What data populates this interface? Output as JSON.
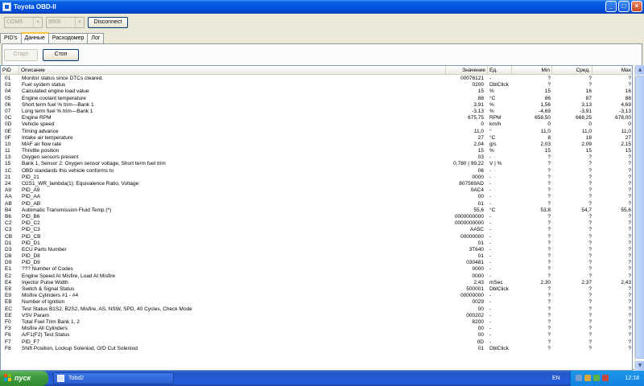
{
  "window": {
    "title": "Toyota OBD-II"
  },
  "toolbar": {
    "port_value": "COM5",
    "baud_value": "9600",
    "disconnect_label": "Disconnect",
    "start_label": "Старт",
    "stop_label": "Стоп"
  },
  "tabs": [
    {
      "label": "PID's"
    },
    {
      "label": "Данные"
    },
    {
      "label": "Расходомер"
    },
    {
      "label": "Лог"
    }
  ],
  "columns": {
    "pid": "PID",
    "desc": "Описание",
    "value": "Значение",
    "unit": "Ед.",
    "min": "Min",
    "avg": "Сред.",
    "max": "Max"
  },
  "rows": [
    {
      "pid": "01",
      "desc": "Monitor status since DTCs cleared.",
      "value": "00076121",
      "unit": "-",
      "min": "?",
      "avg": "?",
      "max": "?"
    },
    {
      "pid": "03",
      "desc": "Fuel system status",
      "value": "0200",
      "unit": "DblClick",
      "min": "?",
      "avg": "?",
      "max": "?"
    },
    {
      "pid": "04",
      "desc": "Calculated engine load value",
      "value": "15",
      "unit": "%",
      "min": "15",
      "avg": "16",
      "max": "16"
    },
    {
      "pid": "05",
      "desc": "Engine coolant temperature",
      "value": "88",
      "unit": "°C",
      "min": "86",
      "avg": "87",
      "max": "88"
    },
    {
      "pid": "06",
      "desc": "Short term fuel % trim—Bank 1",
      "value": "3,91",
      "unit": "%",
      "min": "1,56",
      "avg": "3,13",
      "max": "4,69"
    },
    {
      "pid": "07",
      "desc": "Long term fuel % trim—Bank 1",
      "value": "-3,13",
      "unit": "%",
      "min": "-4,69",
      "avg": "-3,91",
      "max": "-3,13"
    },
    {
      "pid": "0C",
      "desc": "Engine RPM",
      "value": "675,75",
      "unit": "RPM",
      "min": "658,50",
      "avg": "668,25",
      "max": "678,00"
    },
    {
      "pid": "0D",
      "desc": "Vehicle speed",
      "value": "0",
      "unit": "km/h",
      "min": "0",
      "avg": "0",
      "max": "0"
    },
    {
      "pid": "0E",
      "desc": "Timing advance",
      "value": "11,0",
      "unit": "°",
      "min": "11,0",
      "avg": "11,0",
      "max": "11,0"
    },
    {
      "pid": "0F",
      "desc": "Intake air temperature",
      "value": "27",
      "unit": "°C",
      "min": "8",
      "avg": "18",
      "max": "27"
    },
    {
      "pid": "10",
      "desc": "MAF air flow rate",
      "value": "2,04",
      "unit": "g/s",
      "min": "2,03",
      "avg": "2,09",
      "max": "2,15"
    },
    {
      "pid": "11",
      "desc": "Throttle position",
      "value": "15",
      "unit": "%",
      "min": "15",
      "avg": "15",
      "max": "15"
    },
    {
      "pid": "13",
      "desc": "Oxygen sensors present",
      "value": "03",
      "unit": "-",
      "min": "?",
      "avg": "?",
      "max": "?"
    },
    {
      "pid": "15",
      "desc": "Bank 1, Sensor 2: Oxygen sensor voltage, Short term fuel trim",
      "value": "0,780 | 99,22",
      "unit": "V | %",
      "min": "?",
      "avg": "?",
      "max": "?"
    },
    {
      "pid": "1C",
      "desc": "OBD standards this vehicle conforms to",
      "value": "06",
      "unit": "-",
      "min": "?",
      "avg": "?",
      "max": "?"
    },
    {
      "pid": "21",
      "desc": "PID_21",
      "value": "0000",
      "unit": "-",
      "min": "?",
      "avg": "?",
      "max": "?"
    },
    {
      "pid": "24",
      "desc": "O2S1_WR_lambda(1): Equivalence Ratio, Voltage",
      "value": "807569AD",
      "unit": "-",
      "min": "?",
      "avg": "?",
      "max": "?"
    },
    {
      "pid": "A9",
      "desc": "PID_A9",
      "value": "0AC4",
      "unit": "-",
      "min": "?",
      "avg": "?",
      "max": "?"
    },
    {
      "pid": "AA",
      "desc": "PID_AA",
      "value": "00",
      "unit": "-",
      "min": "?",
      "avg": "?",
      "max": "?"
    },
    {
      "pid": "AB",
      "desc": "PID_AB",
      "value": "01",
      "unit": "-",
      "min": "?",
      "avg": "?",
      "max": "?"
    },
    {
      "pid": "B4",
      "desc": "Automatic Transmission Fluid Temp (*)",
      "value": "55,6",
      "unit": "°C",
      "min": "53,8",
      "avg": "54,7",
      "max": "55,6"
    },
    {
      "pid": "B6",
      "desc": "PID_B6",
      "value": "0000000000",
      "unit": "-",
      "min": "?",
      "avg": "?",
      "max": "?"
    },
    {
      "pid": "C2",
      "desc": "PID_C2",
      "value": "0000000000",
      "unit": "-",
      "min": "?",
      "avg": "?",
      "max": "?"
    },
    {
      "pid": "C3",
      "desc": "PID_C3",
      "value": "AA5C",
      "unit": "-",
      "min": "?",
      "avg": "?",
      "max": "?"
    },
    {
      "pid": "CB",
      "desc": "PID_CB",
      "value": "00000000",
      "unit": "-",
      "min": "?",
      "avg": "?",
      "max": "?"
    },
    {
      "pid": "D1",
      "desc": "PID_D1",
      "value": "01",
      "unit": "-",
      "min": "?",
      "avg": "?",
      "max": "?"
    },
    {
      "pid": "D3",
      "desc": "ECU Parts Number",
      "value": "3T640",
      "unit": "-",
      "min": "?",
      "avg": "?",
      "max": "?"
    },
    {
      "pid": "D8",
      "desc": "PID_D8",
      "value": "01",
      "unit": "-",
      "min": "?",
      "avg": "?",
      "max": "?"
    },
    {
      "pid": "D9",
      "desc": "PID_D9",
      "value": "030481",
      "unit": "-",
      "min": "?",
      "avg": "?",
      "max": "?"
    },
    {
      "pid": "E1",
      "desc": "??? Number of Codes",
      "value": "0000",
      "unit": "-",
      "min": "?",
      "avg": "?",
      "max": "?"
    },
    {
      "pid": "E2",
      "desc": "Engine Speed At Misfire, Load At Misfire",
      "value": "0000",
      "unit": "-",
      "min": "?",
      "avg": "?",
      "max": "?"
    },
    {
      "pid": "E4",
      "desc": "Injector Pulse Width",
      "value": "2,43",
      "unit": "mSec",
      "min": "2,30",
      "avg": "2,37",
      "max": "2,43"
    },
    {
      "pid": "E8",
      "desc": "Switch & Signal Status",
      "value": "500001",
      "unit": "DblClick",
      "min": "?",
      "avg": "?",
      "max": "?"
    },
    {
      "pid": "E9",
      "desc": "Misfire Cylinders #1 - #4",
      "value": "00000000",
      "unit": "-",
      "min": "?",
      "avg": "?",
      "max": "?"
    },
    {
      "pid": "EB",
      "desc": "Number of Ignition",
      "value": "0029",
      "unit": "-",
      "min": "?",
      "avg": "?",
      "max": "?"
    },
    {
      "pid": "EC",
      "desc": "Test Status B1S2, B2S2, Misfire, AS, NSW, SPD, 40 Cycles, Check Mode",
      "value": "00",
      "unit": "-",
      "min": "?",
      "avg": "?",
      "max": "?"
    },
    {
      "pid": "EE",
      "desc": "VSV Param",
      "value": "000202",
      "unit": "-",
      "min": "?",
      "avg": "?",
      "max": "?"
    },
    {
      "pid": "F0",
      "desc": "Total Fuel Trim Bank 1, 2",
      "value": "8200",
      "unit": "-",
      "min": "?",
      "avg": "?",
      "max": "?"
    },
    {
      "pid": "F3",
      "desc": "Misfire All Cylinders",
      "value": "00",
      "unit": "-",
      "min": "?",
      "avg": "?",
      "max": "?"
    },
    {
      "pid": "F6",
      "desc": "A/F1(F2) Test Status",
      "value": "00",
      "unit": "-",
      "min": "?",
      "avg": "?",
      "max": "?"
    },
    {
      "pid": "F7",
      "desc": "PID_F7",
      "value": "0D",
      "unit": "-",
      "min": "?",
      "avg": "?",
      "max": "?"
    },
    {
      "pid": "F8",
      "desc": "Shift Position, Lockup Soleniod, O/D Cut Soleniod",
      "value": "01",
      "unit": "DblClick",
      "min": "?",
      "avg": "?",
      "max": "?"
    }
  ],
  "taskbar": {
    "start_label": "пуск",
    "task_label": "Tobd2",
    "language": "EN",
    "clock": "12:18"
  },
  "colors": {
    "titlebar": "#0054e3",
    "taskbar": "#245edb",
    "start": "#3c9a3c"
  }
}
